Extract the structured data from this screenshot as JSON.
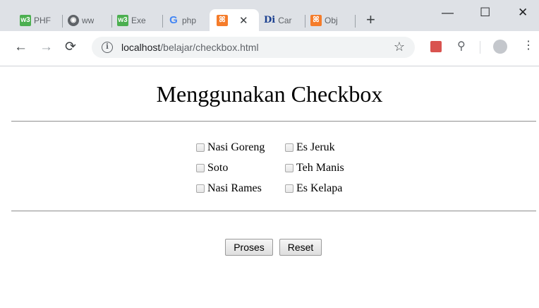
{
  "browser": {
    "tabs": [
      {
        "title": "PHF",
        "favicon": "w3schools-icon"
      },
      {
        "title": "ww",
        "favicon": "globe-icon"
      },
      {
        "title": "Exe",
        "favicon": "w3schools-icon"
      },
      {
        "title": "php",
        "favicon": "google-icon"
      },
      {
        "title": "",
        "favicon": "xampp-icon",
        "active": true
      },
      {
        "title": "Car",
        "favicon": "dictionary-icon"
      },
      {
        "title": "Obj",
        "favicon": "xampp-icon"
      }
    ],
    "new_tab": "+",
    "window_controls": {
      "minimize": "—",
      "maximize": "☐",
      "close": "✕"
    },
    "url_host": "localhost",
    "url_path": "/belajar/checkbox.html"
  },
  "page": {
    "title": "Menggunakan Checkbox",
    "options": [
      [
        "Nasi Goreng",
        "Es Jeruk"
      ],
      [
        "Soto",
        "Teh Manis"
      ],
      [
        "Nasi Rames",
        "Es Kelapa"
      ]
    ],
    "submit_label": "Proses",
    "reset_label": "Reset"
  },
  "colors": {
    "tabstrip": "#dee1e6",
    "omnibox": "#f1f3f4"
  }
}
